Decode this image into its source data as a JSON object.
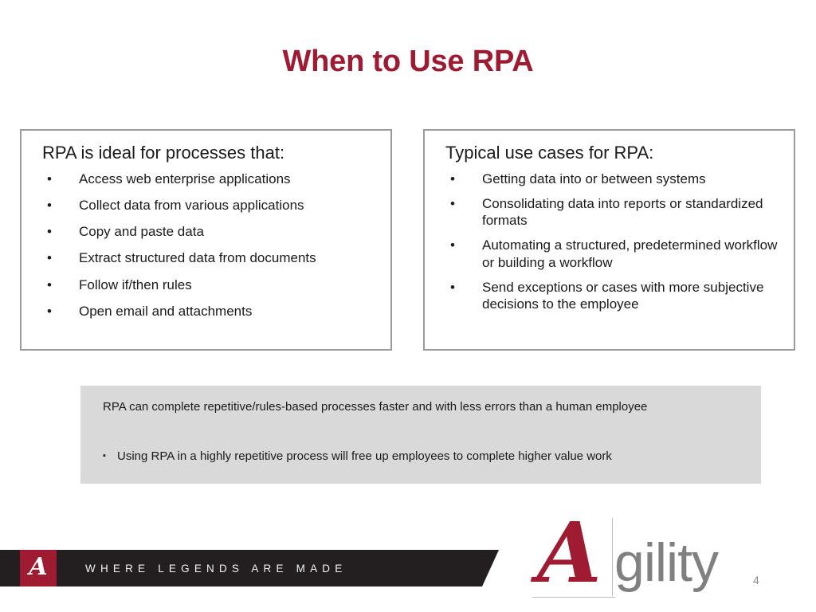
{
  "slide": {
    "title": "When to Use RPA",
    "page_number": "4",
    "accent_color": "#9E1B32",
    "callout_bg": "#d9d9d9",
    "box_border_color": "#9b9b9b"
  },
  "left_box": {
    "heading": "RPA is ideal for processes that:",
    "bullet_glyph": "•",
    "items": [
      "Access web enterprise applications",
      "Collect data from various applications",
      "Copy and paste data",
      "Extract structured data from documents",
      "Follow if/then rules",
      "Open email and attachments"
    ]
  },
  "right_box": {
    "heading": "Typical use cases for RPA:",
    "bullet_glyph": "•",
    "items": [
      "Getting data into or between systems",
      "Consolidating data into reports or standardized formats",
      "Automating a structured, predetermined workflow or building a workflow",
      "Send exceptions or cases with more subjective decisions to the employee"
    ]
  },
  "callout": {
    "paragraph": "RPA can complete repetitive/rules-based processes faster and with less errors than a human employee",
    "bullet_glyph": "▪",
    "bullet_text": "Using RPA in a highly repetitive process will free up employees to complete higher value work"
  },
  "footer": {
    "tagline": "WHERE LEGENDS ARE MADE",
    "logo_letter": "A",
    "banner_color": "#231f20"
  },
  "agility_logo": {
    "letter_a": "A",
    "word_rest": "gility"
  }
}
